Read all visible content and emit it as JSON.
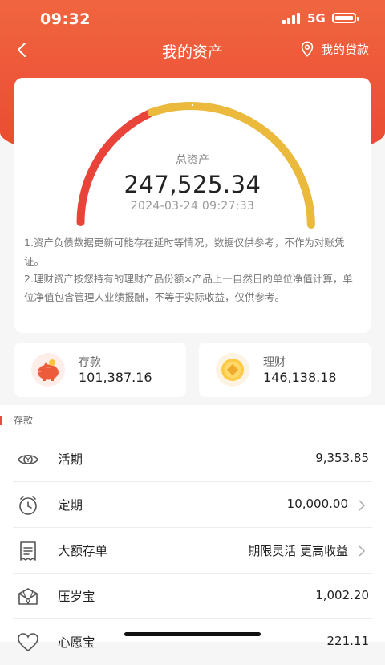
{
  "status_bar": {
    "time": "09:32",
    "network": "5G"
  },
  "nav": {
    "title": "我的资产",
    "loan_label": "我的贷款"
  },
  "summary": {
    "total_label": "总资产",
    "total_value": "247,525.34",
    "timestamp": "2024-03-24 09:27:33",
    "gauge": {
      "red_color": "#e8443a",
      "yellow_color": "#ebb93c"
    },
    "notes": [
      "1.资产负债数据更新可能存在延时等情况，数据仅供参考，不作为对账凭证。",
      "2.理财资产按您持有的理财产品份额×产品上一自然日的单位净值计算，单位净值包含管理人业绩报酬，不等于实际收益，仅供参考。"
    ]
  },
  "categories": [
    {
      "label": "存款",
      "value": "101,387.16",
      "icon": "piggy-bank-icon"
    },
    {
      "label": "理财",
      "value": "146,138.18",
      "icon": "coin-icon"
    }
  ],
  "deposit_section": {
    "title": "存款",
    "rows": [
      {
        "label": "活期",
        "value": "9,353.85",
        "icon": "yuan-eye-icon"
      },
      {
        "label": "定期",
        "value": "10,000.00",
        "icon": "alarm-clock-icon"
      },
      {
        "label": "大额存单",
        "value": "期限灵活 更高收益",
        "icon": "receipt-icon"
      },
      {
        "label": "压岁宝",
        "value": "1,002.20",
        "icon": "red-envelope-icon"
      },
      {
        "label": "心愿宝",
        "value": "221.11",
        "icon": "heart-icon"
      }
    ]
  },
  "colors": {
    "accent": "#ec5438",
    "section_marker": "#e94b3c"
  }
}
